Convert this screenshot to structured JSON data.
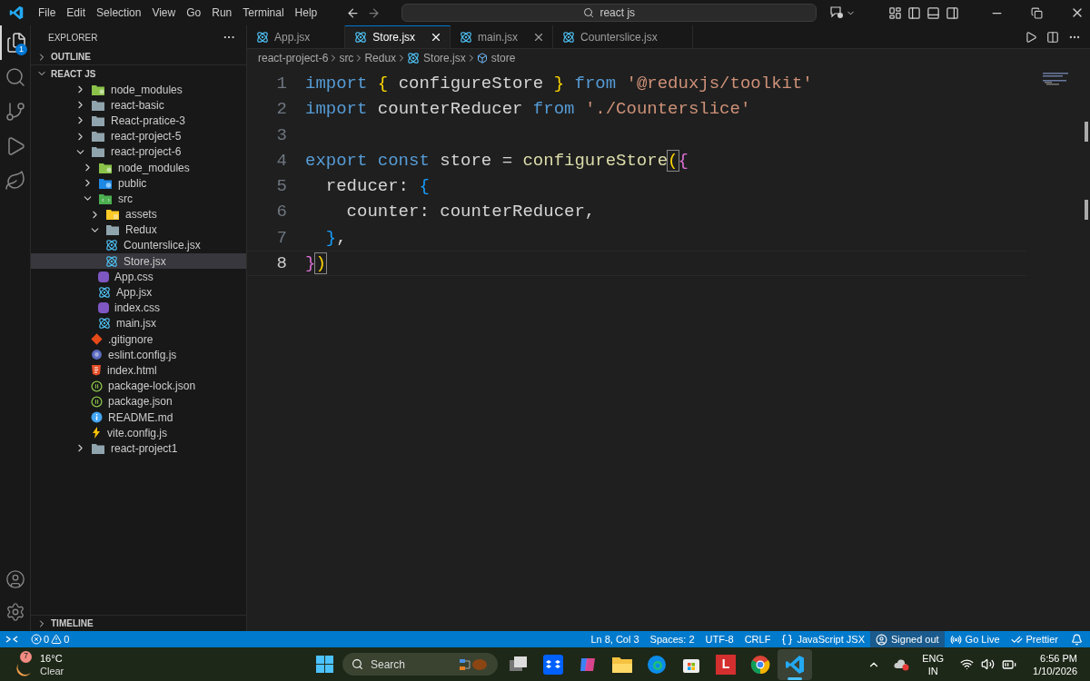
{
  "menu": [
    "File",
    "Edit",
    "Selection",
    "View",
    "Go",
    "Run",
    "Terminal",
    "Help"
  ],
  "search": {
    "value": "react js"
  },
  "activity": [
    {
      "kind": "explorer",
      "selected": true,
      "badge": "1"
    },
    {
      "kind": "search",
      "selected": false
    },
    {
      "kind": "source-control",
      "selected": false
    },
    {
      "kind": "run-debug",
      "selected": false
    },
    {
      "kind": "leaf",
      "selected": false
    }
  ],
  "sidebar": {
    "title": "EXPLORER",
    "more": "···",
    "outline": {
      "label": "OUTLINE",
      "expanded": false
    },
    "timeline": {
      "label": "TIMELINE",
      "expanded": false
    },
    "root": {
      "label": "REACT JS",
      "expanded": true,
      "children": [
        {
          "label": "node_modules",
          "kind": "node-folder",
          "expanded": false,
          "selected": false
        },
        {
          "label": "react-basic",
          "kind": "folder",
          "expanded": false,
          "selected": false
        },
        {
          "label": "React-pratice-3",
          "kind": "folder",
          "expanded": false,
          "selected": false
        },
        {
          "label": "react-project-5",
          "kind": "folder",
          "expanded": false,
          "selected": false
        },
        {
          "label": "react-project-6",
          "kind": "folder",
          "expanded": true,
          "selected": false,
          "children": [
            {
              "label": "node_modules",
              "kind": "node-folder",
              "expanded": false,
              "selected": false
            },
            {
              "label": "public",
              "kind": "public-folder",
              "expanded": false,
              "selected": false
            },
            {
              "label": "src",
              "kind": "src-folder",
              "expanded": true,
              "selected": false,
              "children": [
                {
                  "label": "assets",
                  "kind": "assets-folder",
                  "expanded": false,
                  "selected": false
                },
                {
                  "label": "Redux",
                  "kind": "folder",
                  "expanded": true,
                  "selected": false,
                  "children": [
                    {
                      "label": "Counterslice.jsx",
                      "kind": "react",
                      "selected": false
                    },
                    {
                      "label": "Store.jsx",
                      "kind": "react",
                      "selected": true
                    }
                  ]
                },
                {
                  "label": "App.css",
                  "kind": "css",
                  "selected": false
                },
                {
                  "label": "App.jsx",
                  "kind": "react",
                  "selected": false
                },
                {
                  "label": "index.css",
                  "kind": "css",
                  "selected": false
                },
                {
                  "label": "main.jsx",
                  "kind": "react",
                  "selected": false
                }
              ]
            },
            {
              "label": ".gitignore",
              "kind": "git",
              "selected": false
            },
            {
              "label": "eslint.config.js",
              "kind": "eslint",
              "selected": false
            },
            {
              "label": "index.html",
              "kind": "html",
              "selected": false
            },
            {
              "label": "package-lock.json",
              "kind": "json",
              "selected": false
            },
            {
              "label": "package.json",
              "kind": "json",
              "selected": false
            },
            {
              "label": "README.md",
              "kind": "info",
              "selected": false
            },
            {
              "label": "vite.config.js",
              "kind": "vite",
              "selected": false
            }
          ]
        },
        {
          "label": "react-project1",
          "kind": "folder",
          "expanded": false,
          "selected": false
        }
      ]
    }
  },
  "tabs": [
    {
      "label": "App.jsx",
      "selected": false,
      "close_button": false
    },
    {
      "label": "Store.jsx",
      "selected": true,
      "close_button": true
    },
    {
      "label": "main.jsx",
      "selected": false,
      "close_button": true
    },
    {
      "label": "Counterslice.jsx",
      "selected": false,
      "close_button": false
    }
  ],
  "breadcrumbs": [
    {
      "label": "react-project-6",
      "kind": "plain"
    },
    {
      "label": "src",
      "kind": "plain"
    },
    {
      "label": "Redux",
      "kind": "plain"
    },
    {
      "label": "Store.jsx",
      "kind": "react"
    },
    {
      "label": "store",
      "kind": "symbol"
    }
  ],
  "code": [
    {
      "number": "1",
      "current": false,
      "tokens": [
        {
          "text": "import ",
          "kind": "keyword"
        },
        {
          "text": "{",
          "kind": "bracket1"
        },
        {
          "text": " configureStore ",
          "kind": "plain"
        },
        {
          "text": "}",
          "kind": "bracket1"
        },
        {
          "text": " from ",
          "kind": "keyword"
        },
        {
          "text": "'@reduxjs/toolkit'",
          "kind": "string"
        }
      ]
    },
    {
      "number": "2",
      "current": false,
      "tokens": [
        {
          "text": "import",
          "kind": "keyword"
        },
        {
          "text": " counterReducer ",
          "kind": "plain"
        },
        {
          "text": "from ",
          "kind": "keyword"
        },
        {
          "text": "'./Counterslice'",
          "kind": "string"
        }
      ]
    },
    {
      "number": "3",
      "current": false
    },
    {
      "number": "4",
      "current": false,
      "tokens": [
        {
          "text": "export const",
          "kind": "keyword"
        },
        {
          "text": " store = ",
          "kind": "plain"
        },
        {
          "text": "configureStore",
          "kind": "function"
        },
        {
          "text": "(",
          "kind": "bracket1-matched"
        },
        {
          "text": "{",
          "kind": "bracket2"
        }
      ]
    },
    {
      "number": "5",
      "current": false,
      "tokens": [
        {
          "text": "  reducer: ",
          "kind": "plain"
        },
        {
          "text": "{",
          "kind": "bracket3"
        }
      ]
    },
    {
      "number": "6",
      "current": false,
      "tokens": [
        {
          "text": "    counter: counterReducer,",
          "kind": "plain"
        }
      ]
    },
    {
      "number": "7",
      "current": false,
      "tokens": [
        {
          "text": "  }",
          "kind": "bracket3"
        },
        {
          "text": ",",
          "kind": "plain"
        }
      ]
    },
    {
      "number": "8",
      "current": true,
      "tokens": [
        {
          "text": "}",
          "kind": "bracket2"
        },
        {
          "text": ")",
          "kind": "bracket1-matched"
        }
      ]
    }
  ],
  "status_bar": {
    "errors": "0",
    "warnings": "0",
    "items": [
      {
        "label": "Ln 8, Col 3",
        "kind": "plain"
      },
      {
        "label": "Spaces: 2",
        "kind": "plain"
      },
      {
        "label": "UTF-8",
        "kind": "plain"
      },
      {
        "label": "CRLF",
        "kind": "plain"
      },
      {
        "label": "JavaScript JSX",
        "kind": "braces"
      },
      {
        "label": "Signed out",
        "kind": "account"
      },
      {
        "label": "Go Live",
        "kind": "broadcast"
      },
      {
        "label": "Prettier",
        "kind": "check"
      }
    ]
  },
  "taskbar": {
    "weather": {
      "badge": "7",
      "temperature": "16°C",
      "condition": "Clear"
    },
    "search": {
      "placeholder": "Search"
    },
    "apps": [
      {
        "kind": "task-view",
        "selected": false
      },
      {
        "kind": "dropbox",
        "selected": false
      },
      {
        "kind": "copilot",
        "selected": false
      },
      {
        "kind": "files",
        "selected": false
      },
      {
        "kind": "edge",
        "selected": false
      },
      {
        "kind": "store",
        "selected": false
      },
      {
        "kind": "letter-app",
        "label": "L",
        "selected": false
      },
      {
        "kind": "chrome",
        "selected": false
      },
      {
        "kind": "vscode",
        "selected": true
      }
    ],
    "language": "ENG",
    "region": "IN",
    "time": "6:56 PM",
    "date": "1/10/2026"
  }
}
